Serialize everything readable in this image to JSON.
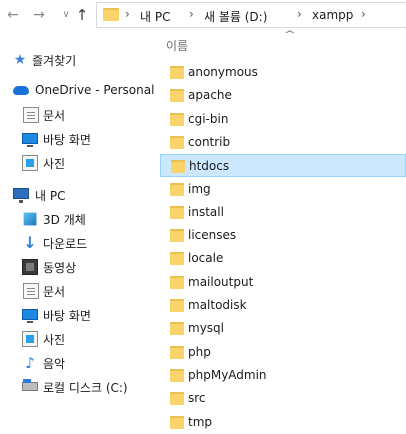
{
  "nav": {
    "back_icon": "back-arrow-icon",
    "forward_icon": "forward-arrow-icon",
    "recent_icon": "chevron-down-icon",
    "up_icon": "up-arrow-icon"
  },
  "address": {
    "sep1": "›",
    "crumbs": [
      "내 PC",
      "새 볼륨 (D:)",
      "xampp"
    ],
    "sep2": "›",
    "sep3": "›",
    "sep4": "›"
  },
  "sort_indicator": "^",
  "column_header": "이름",
  "sidebar": {
    "items": [
      {
        "label": "즐겨찾기",
        "icon": "star-icon"
      },
      {
        "label": "OneDrive - Personal",
        "icon": "cloud-icon"
      },
      {
        "label": "문서",
        "icon": "document-icon"
      },
      {
        "label": "바탕 화면",
        "icon": "desktop-icon"
      },
      {
        "label": "사진",
        "icon": "pictures-icon"
      },
      {
        "label": "내 PC",
        "icon": "computer-icon"
      },
      {
        "label": "3D 개체",
        "icon": "3d-objects-icon"
      },
      {
        "label": "다운로드",
        "icon": "download-icon"
      },
      {
        "label": "동영상",
        "icon": "video-icon"
      },
      {
        "label": "문서",
        "icon": "document-icon"
      },
      {
        "label": "바탕 화면",
        "icon": "desktop-icon"
      },
      {
        "label": "사진",
        "icon": "pictures-icon"
      },
      {
        "label": "음악",
        "icon": "music-icon"
      },
      {
        "label": "로컬 디스크 (C:)",
        "icon": "drive-icon"
      }
    ]
  },
  "files": {
    "selected_index": 4,
    "items": [
      "anonymous",
      "apache",
      "cgi-bin",
      "contrib",
      "htdocs",
      "img",
      "install",
      "licenses",
      "locale",
      "mailoutput",
      "maltodisk",
      "mysql",
      "php",
      "phpMyAdmin",
      "src",
      "tmp"
    ]
  },
  "colors": {
    "selection_bg": "#cce8ff",
    "selection_border": "#99d1ff",
    "folder": "#f8d46a"
  }
}
